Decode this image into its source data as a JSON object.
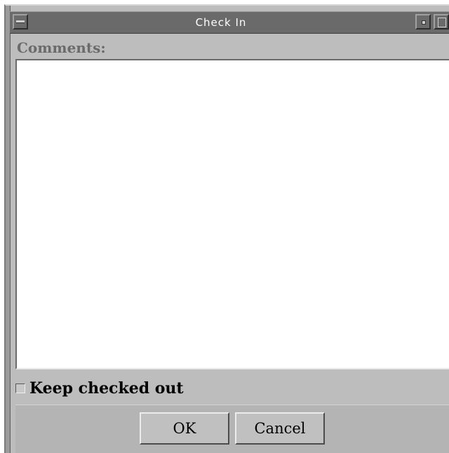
{
  "window": {
    "title": "Check In"
  },
  "comments": {
    "label": "Comments:",
    "value": ""
  },
  "keep_checked_out": {
    "label": "Keep checked out",
    "checked": false
  },
  "buttons": {
    "ok_label": "OK",
    "cancel_label": "Cancel"
  },
  "icons": {
    "window_menu": "window-menu-icon",
    "minimize": "minimize-icon",
    "maximize": "maximize-icon"
  }
}
